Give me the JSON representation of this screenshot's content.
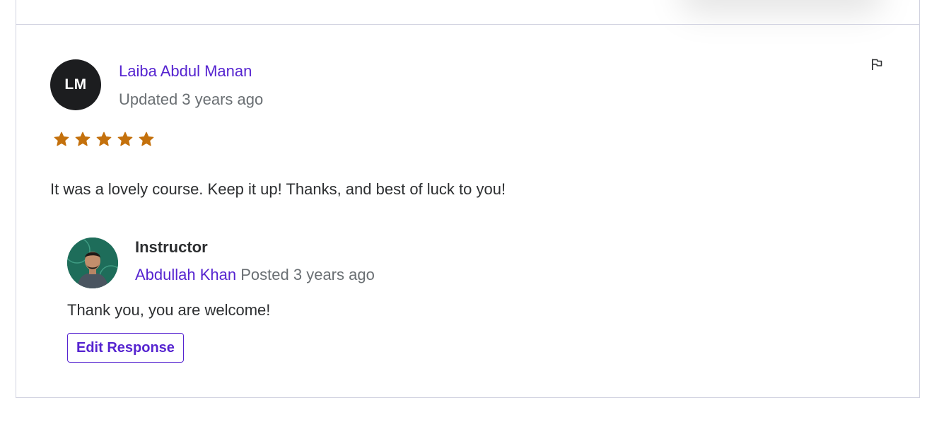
{
  "review": {
    "reviewer": {
      "initials": "LM",
      "name": "Laiba Abdul Manan",
      "time": "Updated 3 years ago"
    },
    "rating": 5,
    "rating_max": 5,
    "body": "It was a lovely course. Keep it up! Thanks, and best of luck to you!",
    "flag_icon": "flag-icon"
  },
  "response": {
    "role": "Instructor",
    "name": "Abdullah Khan",
    "time": "Posted 3 years ago",
    "body": "Thank you, you are welcome!",
    "edit_label": "Edit Response"
  },
  "colors": {
    "accent": "#5624d0",
    "star": "#c4710d",
    "avatar_bg": "#1c1d1f",
    "muted_text": "#6a6f73",
    "border": "#d1d2e0"
  }
}
